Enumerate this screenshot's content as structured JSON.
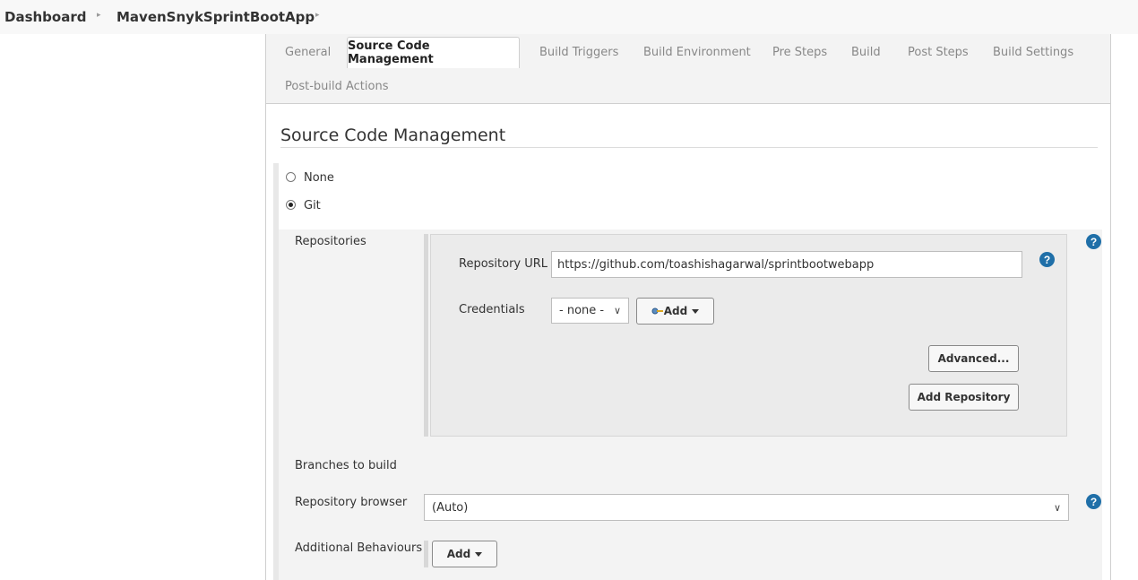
{
  "breadcrumb": {
    "items": [
      "Dashboard",
      "MavenSnykSprintBootApp"
    ]
  },
  "tabs": [
    {
      "label": "General"
    },
    {
      "label": "Source Code Management",
      "active": true
    },
    {
      "label": "Build Triggers"
    },
    {
      "label": "Build Environment"
    },
    {
      "label": "Pre Steps"
    },
    {
      "label": "Build"
    },
    {
      "label": "Post Steps"
    },
    {
      "label": "Build Settings"
    },
    {
      "label": "Post-build Actions"
    }
  ],
  "section": {
    "title": "Source Code Management"
  },
  "scm_options": {
    "none_label": "None",
    "git_label": "Git",
    "selected": "Git"
  },
  "git": {
    "repositories_label": "Repositories",
    "repository_url_label": "Repository URL",
    "repository_url_value": "https://github.com/toashishagarwal/sprintbootwebapp",
    "credentials_label": "Credentials",
    "credentials_value": "- none -",
    "add_credentials_label": "Add",
    "advanced_label": "Advanced...",
    "add_repository_label": "Add Repository",
    "branches_label": "Branches to build",
    "repo_browser_label": "Repository browser",
    "repo_browser_value": "(Auto)",
    "additional_behaviours_label": "Additional Behaviours",
    "add_behaviour_label": "Add"
  },
  "help_glyph": "?",
  "colors": {
    "help_icon": "#1f6fa8",
    "breadcrumb_bg": "#f8f8f8",
    "panel_bg": "#f3f3f3"
  },
  "icons": [
    "chevron-right-icon",
    "help-icon",
    "key-icon",
    "dropdown-caret-icon",
    "chevron-down-icon"
  ]
}
